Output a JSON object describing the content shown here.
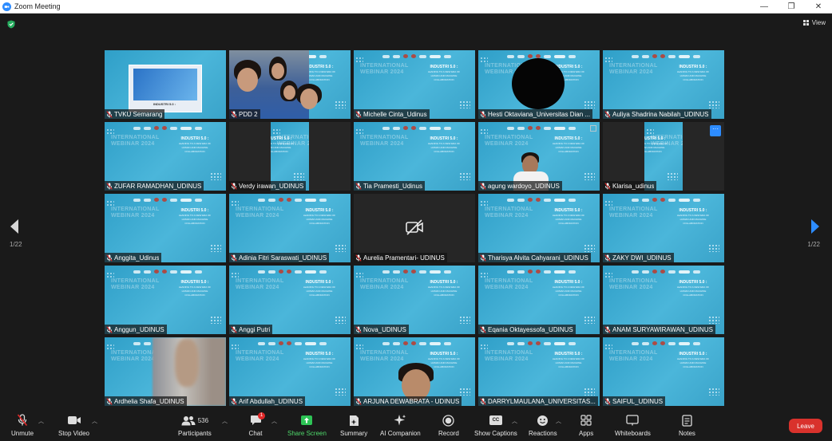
{
  "window": {
    "title": "Zoom Meeting",
    "minimize": "—",
    "restore": "❐",
    "close": "✕"
  },
  "meeting": {
    "view_label": "View",
    "page_left": "1/22",
    "page_right": "1/22"
  },
  "tiles": [
    {
      "name": "TVKU Semarang"
    },
    {
      "name": "PDD 2"
    },
    {
      "name": "Michelle Cinta_Udinus"
    },
    {
      "name": "Hesti Oktaviana_Universitas Dian ..."
    },
    {
      "name": "Auliya Shadrina Nabilah_UDINUS"
    },
    {
      "name": "ZUFAR RAMADHAN_UDINUS"
    },
    {
      "name": "Verdy irawan_UDINUS"
    },
    {
      "name": "Tia Pramesti_Udinus"
    },
    {
      "name": "agung wardoyo_UDINUS"
    },
    {
      "name": "Klarisa_udinus"
    },
    {
      "name": "Anggita_Udinus"
    },
    {
      "name": "Adinia Fitri Saraswati_UDINUS"
    },
    {
      "name": "Aurelia Pramentari- UDINUS"
    },
    {
      "name": "Tharisya Alvita Cahyarani_UDINUS"
    },
    {
      "name": "ZAKY DWI_UDINUS"
    },
    {
      "name": "Anggun_UDINUS"
    },
    {
      "name": "Anggi Putri"
    },
    {
      "name": "Nova_UDINUS"
    },
    {
      "name": "Eqania Oktayessofa_UDINUS"
    },
    {
      "name": "ANAM SURYAWIRAWAN_UDINUS"
    },
    {
      "name": "Ardhelia Shafa_UDINUS"
    },
    {
      "name": "Arif Abdullah_UDINUS"
    },
    {
      "name": "ARJUNA DEWABRATA - UDINUS"
    },
    {
      "name": "DARRYLMAULANA_UNIVERSITAS..."
    },
    {
      "name": "SAIFUL_UDINUS"
    }
  ],
  "slide": {
    "watermark_line1": "INTERNATIONAL",
    "watermark_line2": "WEBINAR 2024",
    "headline": "INDUSTRI 5.0 :",
    "subline1": "LEADING TO A NEW ERA OF",
    "subline2": "HUMAN AND MACHINE",
    "subline3": "COLLABORATION",
    "share_caption": "INDUSTRI 5.0 :"
  },
  "toolbar": {
    "unmute": "Unmute",
    "stop_video": "Stop Video",
    "participants": "Participants",
    "participants_count": "536",
    "chat": "Chat",
    "chat_badge": "1",
    "share_screen": "Share Screen",
    "summary": "Summary",
    "ai_companion": "AI Companion",
    "record": "Record",
    "show_captions": "Show Captions",
    "captions_icon_text": "CC",
    "reactions": "Reactions",
    "apps": "Apps",
    "whiteboards": "Whiteboards",
    "notes": "Notes",
    "leave": "Leave"
  },
  "colors": {
    "accent": "#2d8cff",
    "active_speaker": "#9fdc3a",
    "leave": "#d9322c",
    "share_green": "#4fd96b",
    "muted_red": "#e02828"
  }
}
